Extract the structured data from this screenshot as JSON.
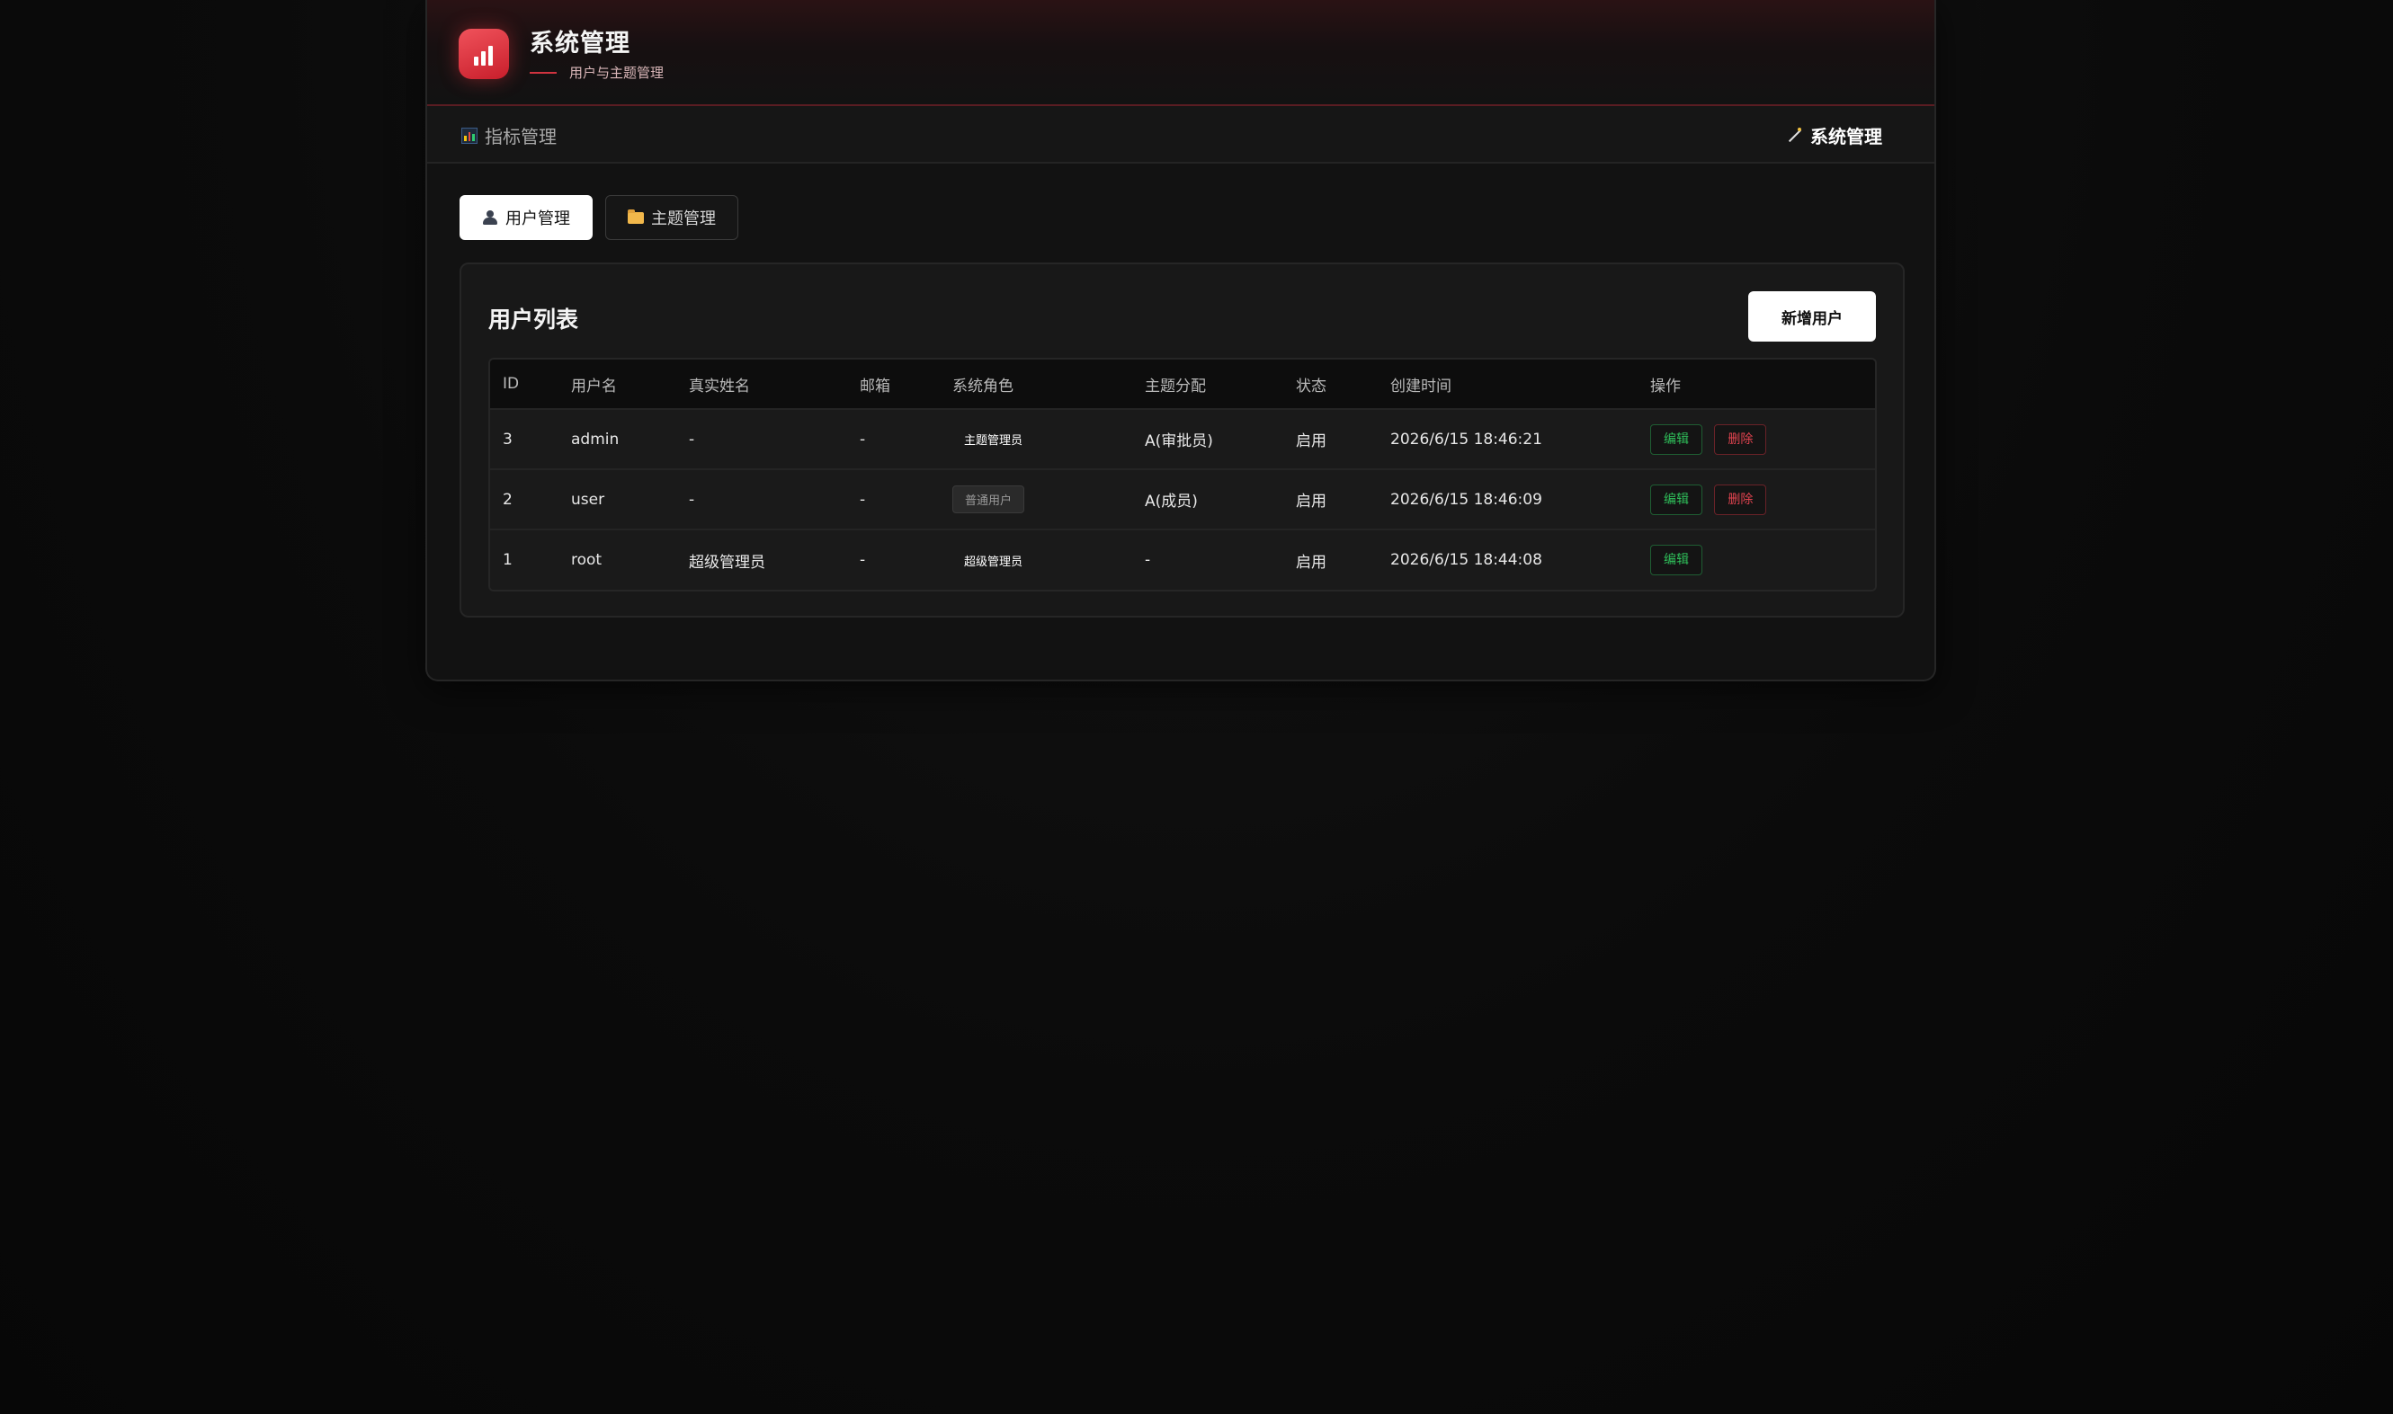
{
  "header": {
    "title": "系统管理",
    "subtitle": "用户与主题管理"
  },
  "nav": {
    "left_label": "指标管理",
    "right_label": "系统管理"
  },
  "tabs": [
    {
      "label": "用户管理",
      "active": true,
      "icon": "user-icon"
    },
    {
      "label": "主题管理",
      "active": false,
      "icon": "folder-icon"
    }
  ],
  "card": {
    "title": "用户列表",
    "add_button": "新增用户"
  },
  "table": {
    "columns": [
      "ID",
      "用户名",
      "真实姓名",
      "邮箱",
      "系统角色",
      "主题分配",
      "状态",
      "创建时间",
      "操作"
    ],
    "rows": [
      {
        "id": "3",
        "username": "admin",
        "real_name": "-",
        "email": "-",
        "role": "主题管理员",
        "topic": "A(审批员)",
        "status": "启用",
        "created": "2026/6/15 18:46:21",
        "edit": "编辑",
        "delete": "删除"
      },
      {
        "id": "2",
        "username": "user",
        "real_name": "-",
        "email": "-",
        "role": "普通用户",
        "topic": "A(成员)",
        "status": "启用",
        "created": "2026/6/15 18:46:09",
        "edit": "编辑",
        "delete": "删除"
      },
      {
        "id": "1",
        "username": "root",
        "real_name": "超级管理员",
        "email": "-",
        "role": "超级管理员",
        "topic": "-",
        "status": "启用",
        "created": "2026/6/15 18:44:08",
        "edit": "编辑"
      }
    ]
  },
  "colors": {
    "accent": "#d0333f",
    "edit": "#2fbf5a",
    "delete": "#e0434f"
  }
}
